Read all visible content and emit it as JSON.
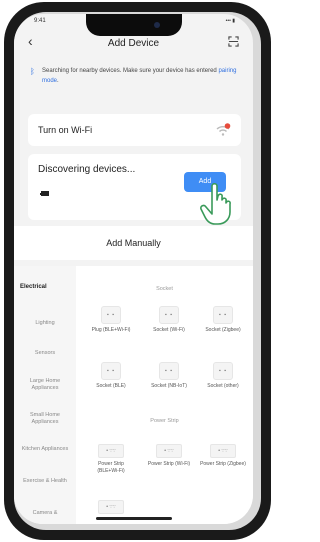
{
  "status": {
    "time": "9:41",
    "indicators": "••• ▮"
  },
  "header": {
    "title": "Add Device",
    "back_icon": "chevron-left-icon",
    "scan_icon": "scan-icon"
  },
  "hint": {
    "text": "Searching for nearby devices. Make sure your device has entered ",
    "link": "pairing mode",
    "end": ".",
    "icon": "bluetooth-icon"
  },
  "wifi": {
    "label": "Turn on Wi-Fi",
    "icon": "wifi-off-icon"
  },
  "discovering": {
    "label": "Discovering devices...",
    "add_label": "Add",
    "device_icon": "device-icon",
    "hand_icon": "pointer-hand-icon"
  },
  "manual": {
    "title": "Add Manually"
  },
  "sidebar": {
    "items": [
      {
        "label": "Electrical",
        "active": true
      },
      {
        "label": "Lighting"
      },
      {
        "label": "Sensors"
      },
      {
        "label": "Large Home Appliances"
      },
      {
        "label": "Small Home Appliances"
      },
      {
        "label": "Kitchen Appliances"
      },
      {
        "label": "Exercise & Health"
      },
      {
        "label": "Camera &"
      }
    ]
  },
  "sections": {
    "socket": "Socket",
    "power_strip": "Power Strip"
  },
  "socket_tiles": [
    {
      "name": "Plug (BLE+Wi-Fi)"
    },
    {
      "name": "Socket (Wi-Fi)"
    },
    {
      "name": "Socket (Zigbee)"
    },
    {
      "name": "Socket (BLE)"
    },
    {
      "name": "Socket (NB-IoT)"
    },
    {
      "name": "Socket (other)"
    }
  ],
  "strip_tiles": [
    {
      "name": "Power Strip (BLE+Wi-Fi)"
    },
    {
      "name": "Power Strip (Wi-Fi)"
    },
    {
      "name": "Power Strip (Zigbee)"
    },
    {
      "name": ""
    }
  ],
  "colors": {
    "accent": "#3f8df5",
    "wifi_badge": "#e74c3c"
  }
}
